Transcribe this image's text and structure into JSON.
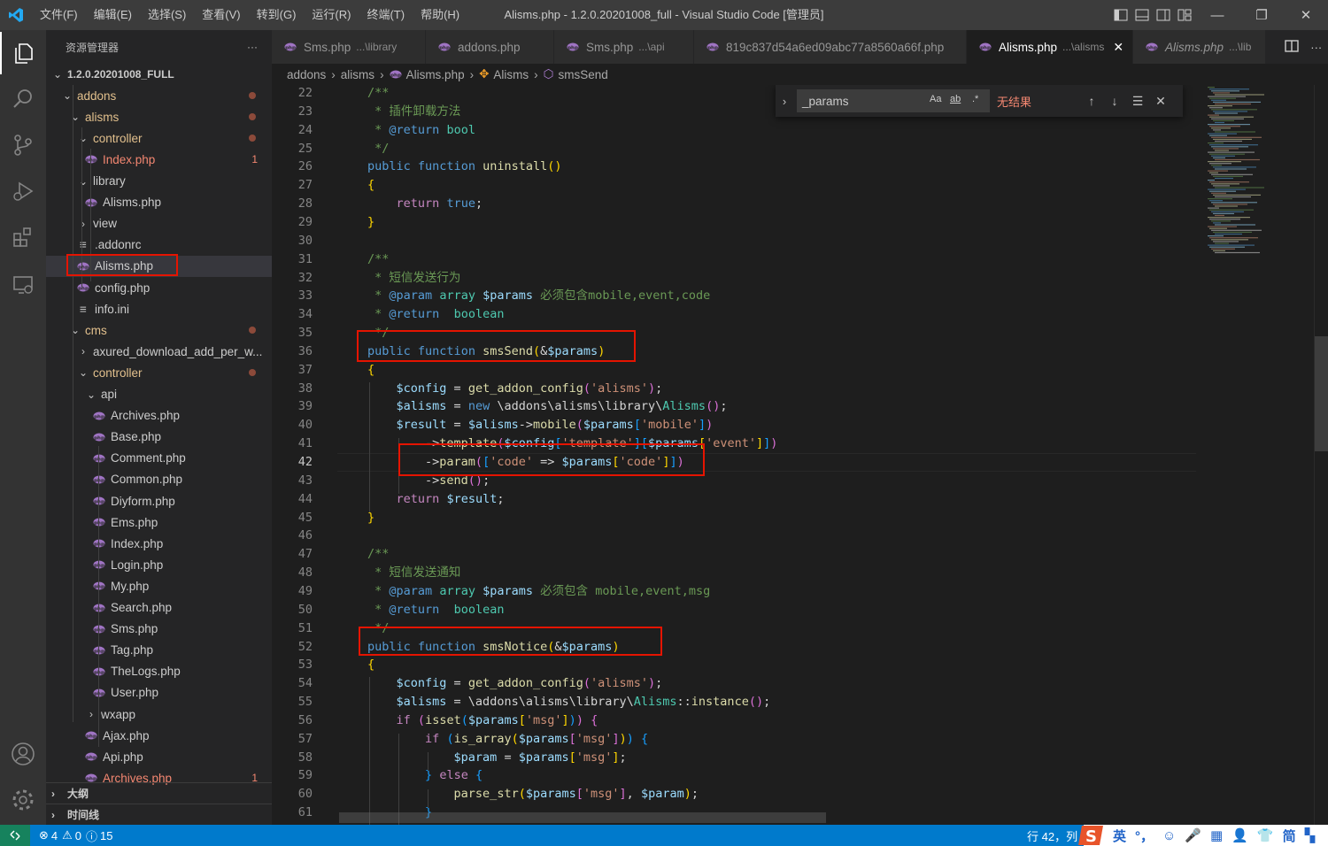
{
  "menu": [
    "文件(F)",
    "编辑(E)",
    "选择(S)",
    "查看(V)",
    "转到(G)",
    "运行(R)",
    "终端(T)",
    "帮助(H)"
  ],
  "window_title": "Alisms.php - 1.2.0.20201008_full - Visual Studio Code [管理员]",
  "colors": {
    "accent": "#007acc",
    "title_bg": "#3c3c3c",
    "sidebar_bg": "#252526",
    "editor_bg": "#1e1e1e",
    "highlight_box": "#e51400",
    "php_icon": "#a074c4"
  },
  "sidebar": {
    "title": "资源管理器",
    "more": "···",
    "tree": [
      {
        "label": "1.2.0.20201008_FULL",
        "indent": 0,
        "type": "root",
        "open": true,
        "bold": true
      },
      {
        "label": "addons",
        "indent": 1,
        "type": "folder",
        "open": true,
        "color": "#e2c08d",
        "dot": true
      },
      {
        "label": "alisms",
        "indent": 2,
        "type": "folder",
        "open": true,
        "color": "#e2c08d",
        "dot": true
      },
      {
        "label": "controller",
        "indent": 3,
        "type": "folder",
        "open": true,
        "color": "#e2c08d",
        "dot": true
      },
      {
        "label": "Index.php",
        "indent": 4,
        "type": "php",
        "color": "#f48771",
        "badge": "1"
      },
      {
        "label": "library",
        "indent": 3,
        "type": "folder",
        "open": true
      },
      {
        "label": "Alisms.php",
        "indent": 4,
        "type": "php"
      },
      {
        "label": "view",
        "indent": 3,
        "type": "folder",
        "open": false
      },
      {
        "label": ".addonrc",
        "indent": 3,
        "type": "text"
      },
      {
        "label": "Alisms.php",
        "indent": 3,
        "type": "php",
        "selected": true
      },
      {
        "label": "config.php",
        "indent": 3,
        "type": "php"
      },
      {
        "label": "info.ini",
        "indent": 3,
        "type": "text"
      },
      {
        "label": "cms",
        "indent": 2,
        "type": "folder",
        "open": true,
        "color": "#e2c08d",
        "dot": true
      },
      {
        "label": "axured_download_add_per_w...",
        "indent": 3,
        "type": "folder",
        "open": false
      },
      {
        "label": "controller",
        "indent": 3,
        "type": "folder",
        "open": true,
        "color": "#e2c08d",
        "dot": true
      },
      {
        "label": "api",
        "indent": 4,
        "type": "folder",
        "open": true
      },
      {
        "label": "Archives.php",
        "indent": 5,
        "type": "php"
      },
      {
        "label": "Base.php",
        "indent": 5,
        "type": "php"
      },
      {
        "label": "Comment.php",
        "indent": 5,
        "type": "php"
      },
      {
        "label": "Common.php",
        "indent": 5,
        "type": "php"
      },
      {
        "label": "Diyform.php",
        "indent": 5,
        "type": "php"
      },
      {
        "label": "Ems.php",
        "indent": 5,
        "type": "php"
      },
      {
        "label": "Index.php",
        "indent": 5,
        "type": "php"
      },
      {
        "label": "Login.php",
        "indent": 5,
        "type": "php"
      },
      {
        "label": "My.php",
        "indent": 5,
        "type": "php"
      },
      {
        "label": "Search.php",
        "indent": 5,
        "type": "php"
      },
      {
        "label": "Sms.php",
        "indent": 5,
        "type": "php"
      },
      {
        "label": "Tag.php",
        "indent": 5,
        "type": "php"
      },
      {
        "label": "TheLogs.php",
        "indent": 5,
        "type": "php"
      },
      {
        "label": "User.php",
        "indent": 5,
        "type": "php"
      },
      {
        "label": "wxapp",
        "indent": 4,
        "type": "folder",
        "open": false
      },
      {
        "label": "Ajax.php",
        "indent": 4,
        "type": "php"
      },
      {
        "label": "Api.php",
        "indent": 4,
        "type": "php"
      },
      {
        "label": "Archives.php",
        "indent": 4,
        "type": "php",
        "color": "#f48771",
        "badge": "1"
      }
    ],
    "sections": [
      "大纲",
      "时间线"
    ]
  },
  "tabs": [
    {
      "name": "Sms.php",
      "desc": "...\\library",
      "active": false
    },
    {
      "name": "addons.php",
      "desc": "",
      "active": false
    },
    {
      "name": "Sms.php",
      "desc": "...\\api",
      "active": false
    },
    {
      "name": "819c837d54a6ed09abc77a8560a66f.php",
      "desc": "",
      "active": false
    },
    {
      "name": "Alisms.php",
      "desc": "...\\alisms",
      "active": true
    },
    {
      "name": "Alisms.php",
      "desc": "...\\lib",
      "active": false,
      "italic": true
    }
  ],
  "breadcrumb": [
    "addons",
    "alisms",
    "Alisms.php",
    "Alisms",
    "smsSend"
  ],
  "find": {
    "value": "_params",
    "match_case": "Aa",
    "whole_word": "ab",
    "regex": ".*",
    "result": "无结果"
  },
  "editor": {
    "current_line": 42,
    "lines": [
      {
        "n": 22,
        "html": "<span class='cm'>/**</span>"
      },
      {
        "n": 23,
        "html": "<span class='cm'> * 插件卸载方法</span>"
      },
      {
        "n": 24,
        "html": "<span class='cm'> * </span><span class='kw'>@return</span><span class='cm'> </span><span class='cls'>bool</span>"
      },
      {
        "n": 25,
        "html": "<span class='cm'> */</span>"
      },
      {
        "n": 26,
        "html": "<span class='kw'>public</span> <span class='kw'>function</span> <span class='fn'>uninstall</span><span class='br1'>()</span>"
      },
      {
        "n": 27,
        "html": "<span class='br1'>{</span>"
      },
      {
        "n": 28,
        "html": "    <span class='ctl'>return</span> <span class='kw'>true</span>;"
      },
      {
        "n": 29,
        "html": "<span class='br1'>}</span>"
      },
      {
        "n": 30,
        "html": ""
      },
      {
        "n": 31,
        "html": "<span class='cm'>/**</span>"
      },
      {
        "n": 32,
        "html": "<span class='cm'> * 短信发送行为</span>"
      },
      {
        "n": 33,
        "html": "<span class='cm'> * </span><span class='kw'>@param</span><span class='cm'> </span><span class='cls'>array</span><span class='cm'> </span><span class='var'>$params</span><span class='cm'> 必须包含mobile,event,code</span>"
      },
      {
        "n": 34,
        "html": "<span class='cm'> * </span><span class='kw'>@return</span><span class='cm'>  </span><span class='cls'>boolean</span>"
      },
      {
        "n": 35,
        "html": "<span class='cm'> */</span>"
      },
      {
        "n": 36,
        "html": "<span class='kw'>public</span> <span class='kw'>function</span> <span class='fn'>smsSend</span><span class='br1'>(</span>&amp;<span class='var'>$params</span><span class='br1'>)</span>"
      },
      {
        "n": 37,
        "html": "<span class='br1'>{</span>"
      },
      {
        "n": 38,
        "html": "    <span class='var'>$config</span> = <span class='fn'>get_addon_config</span><span class='br2'>(</span><span class='str'>'alisms'</span><span class='br2'>)</span>;"
      },
      {
        "n": 39,
        "html": "    <span class='var'>$alisms</span> = <span class='kw'>new</span> \\addons\\alisms\\library\\<span class='cls'>Alisms</span><span class='br2'>()</span>;"
      },
      {
        "n": 40,
        "html": "    <span class='var'>$result</span> = <span class='var'>$alisms</span>-><span class='fn'>mobile</span><span class='br2'>(</span><span class='var'>$params</span><span class='br3'>[</span><span class='str'>'mobile'</span><span class='br3'>]</span><span class='br2'>)</span>"
      },
      {
        "n": 41,
        "html": "        -><span class='fn'>template</span><span class='br2'>(</span><span class='var'>$config</span><span class='br3'>[</span><span class='str'>'template'</span><span class='br3'>][</span><span class='var'>$params</span><span class='br1'>[</span><span class='str'>'event'</span><span class='br1'>]</span><span class='br3'>]</span><span class='br2'>)</span>"
      },
      {
        "n": 42,
        "html": "        -><span class='fn'>param</span><span class='br2'>(</span><span class='br3'>[</span><span class='str'>'code'</span> => <span class='var'>$params</span><span class='br1'>[</span><span class='str'>'code'</span><span class='br1'>]</span><span class='br3'>]</span><span class='br2'>)</span>"
      },
      {
        "n": 43,
        "html": "        -><span class='fn'>send</span><span class='br2'>()</span>;"
      },
      {
        "n": 44,
        "html": "    <span class='ctl'>return</span> <span class='var'>$result</span>;"
      },
      {
        "n": 45,
        "html": "<span class='br1'>}</span>"
      },
      {
        "n": 46,
        "html": ""
      },
      {
        "n": 47,
        "html": "<span class='cm'>/**</span>"
      },
      {
        "n": 48,
        "html": "<span class='cm'> * 短信发送通知</span>"
      },
      {
        "n": 49,
        "html": "<span class='cm'> * </span><span class='kw'>@param</span><span class='cm'> </span><span class='cls'>array</span><span class='cm'> </span><span class='var'>$params</span><span class='cm'> 必须包含 mobile,event,msg</span>"
      },
      {
        "n": 50,
        "html": "<span class='cm'> * </span><span class='kw'>@return</span><span class='cm'>  </span><span class='cls'>boolean</span>"
      },
      {
        "n": 51,
        "html": "<span class='cm'> */</span>"
      },
      {
        "n": 52,
        "html": "<span class='kw'>public</span> <span class='kw'>function</span> <span class='fn'>smsNotice</span><span class='br1'>(</span>&amp;<span class='var'>$params</span><span class='br1'>)</span>"
      },
      {
        "n": 53,
        "html": "<span class='br1'>{</span>"
      },
      {
        "n": 54,
        "html": "    <span class='var'>$config</span> = <span class='fn'>get_addon_config</span><span class='br2'>(</span><span class='str'>'alisms'</span><span class='br2'>)</span>;"
      },
      {
        "n": 55,
        "html": "    <span class='var'>$alisms</span> = \\addons\\alisms\\library\\<span class='cls'>Alisms</span>::<span class='fn'>instance</span><span class='br2'>()</span>;"
      },
      {
        "n": 56,
        "html": "    <span class='ctl'>if</span> <span class='br2'>(</span><span class='fn'>isset</span><span class='br3'>(</span><span class='var'>$params</span><span class='br1'>[</span><span class='str'>'msg'</span><span class='br1'>]</span><span class='br3'>)</span><span class='br2'>)</span> <span class='br2'>{</span>"
      },
      {
        "n": 57,
        "html": "        <span class='ctl'>if</span> <span class='br3'>(</span><span class='fn'>is_array</span><span class='br1'>(</span><span class='var'>$params</span><span class='br2'>[</span><span class='str'>'msg'</span><span class='br2'>]</span><span class='br1'>)</span><span class='br3'>)</span> <span class='br3'>{</span>"
      },
      {
        "n": 58,
        "html": "            <span class='var'>$param</span> = <span class='var'>$params</span><span class='br1'>[</span><span class='str'>'msg'</span><span class='br1'>]</span>;"
      },
      {
        "n": 59,
        "html": "        <span class='br3'>}</span> <span class='ctl'>else</span> <span class='br3'>{</span>"
      },
      {
        "n": 60,
        "html": "            <span class='fn'>parse_str</span><span class='br1'>(</span><span class='var'>$params</span><span class='br2'>[</span><span class='str'>'msg'</span><span class='br2'>]</span>, <span class='var'>$param</span><span class='br1'>)</span>;"
      },
      {
        "n": 61,
        "html": "        <span class='br3'>}</span>"
      }
    ]
  },
  "status": {
    "errors": "4",
    "warnings": "0",
    "infos": "15",
    "position": "行 42，列 1",
    "ime": [
      "英",
      "°，",
      "☺",
      "🎤",
      "▦",
      "👤",
      "👕",
      "简",
      "▚"
    ]
  }
}
